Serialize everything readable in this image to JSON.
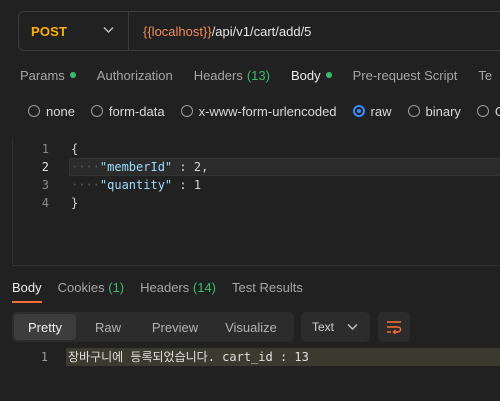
{
  "request": {
    "method": "POST",
    "url_variable": "{{localhost}}",
    "url_path": "/api/v1/cart/add/5"
  },
  "request_tabs": [
    {
      "label": "Params",
      "dot": true
    },
    {
      "label": "Authorization"
    },
    {
      "label": "Headers",
      "count": "(13)"
    },
    {
      "label": "Body",
      "dot": true,
      "active": true
    },
    {
      "label": "Pre-request Script"
    },
    {
      "label": "Te"
    }
  ],
  "body_types": [
    {
      "label": "none"
    },
    {
      "label": "form-data"
    },
    {
      "label": "x-www-form-urlencoded"
    },
    {
      "label": "raw",
      "selected": true
    },
    {
      "label": "binary"
    },
    {
      "label": "G"
    }
  ],
  "editor": {
    "lines": [
      {
        "no": "1",
        "text": "{"
      },
      {
        "no": "2",
        "key": "\"memberId\"",
        "sep": " : ",
        "value": "2,"
      },
      {
        "no": "3",
        "key": "\"quantity\"",
        "sep": " : ",
        "value": "1"
      },
      {
        "no": "4",
        "text": "}"
      }
    ]
  },
  "response_tabs": [
    {
      "label": "Body",
      "active": true
    },
    {
      "label": "Cookies",
      "count": "(1)"
    },
    {
      "label": "Headers",
      "count": "(14)"
    },
    {
      "label": "Test Results"
    }
  ],
  "response_views": [
    "Pretty",
    "Raw",
    "Preview",
    "Visualize"
  ],
  "response_format": "Text",
  "response_body": {
    "line_no": "1",
    "text": "장바구니에 등록되었습니다. cart_id : 13"
  },
  "colors": {
    "method": "#ffb000",
    "url_variable": "#f08c5a",
    "active_tab_underline": "#ff6c37",
    "status_dot": "#3fb970",
    "radio_selected": "#3b8cff"
  }
}
